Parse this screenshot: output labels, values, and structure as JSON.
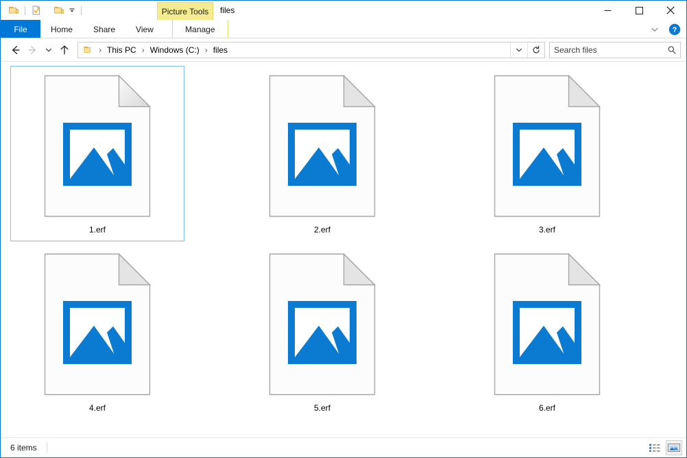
{
  "window": {
    "title": "files",
    "accent_color": "#0078d7",
    "selection_border_color": "#7fc0eb",
    "picture_glyph_color": "#0a7bd0",
    "tools_tab_color": "#f5ec91"
  },
  "quick_access": {
    "items": [
      {
        "name": "new-folder-icon",
        "label": "New folder"
      },
      {
        "name": "properties-icon",
        "label": "Properties"
      },
      {
        "name": "folder-icon",
        "label": "Folder"
      },
      {
        "name": "customize-chevron-icon",
        "label": "Customize Quick Access Toolbar"
      }
    ]
  },
  "contextual_tools": {
    "label": "Picture Tools"
  },
  "window_controls": {
    "minimize": "Minimize",
    "maximize": "Maximize",
    "close": "Close",
    "collapse_ribbon": "Minimize the Ribbon",
    "help": "Help"
  },
  "ribbon": {
    "tabs": [
      {
        "label": "File",
        "active": false,
        "type": "file"
      },
      {
        "label": "Home",
        "active": false,
        "type": "normal"
      },
      {
        "label": "Share",
        "active": false,
        "type": "normal"
      },
      {
        "label": "View",
        "active": false,
        "type": "normal"
      },
      {
        "label": "Manage",
        "active": true,
        "type": "contextual"
      }
    ]
  },
  "navigation": {
    "back": "Back",
    "forward": "Forward",
    "recent": "Recent locations",
    "up": "Up one level",
    "address": {
      "crumbs": [
        "This PC",
        "Windows (C:)",
        "files"
      ],
      "separator": "›",
      "dropdown": "Previous locations",
      "refresh": "Refresh"
    },
    "search": {
      "placeholder": "Search files",
      "value": ""
    }
  },
  "files": {
    "items": [
      {
        "name": "1.erf",
        "selected": true
      },
      {
        "name": "2.erf",
        "selected": false
      },
      {
        "name": "3.erf",
        "selected": false
      },
      {
        "name": "4.erf",
        "selected": false
      },
      {
        "name": "5.erf",
        "selected": false
      },
      {
        "name": "6.erf",
        "selected": false
      }
    ]
  },
  "status": {
    "item_count": "6 items",
    "views": [
      {
        "name": "details-view-button",
        "label": "Details view",
        "active": false
      },
      {
        "name": "large-icons-view-button",
        "label": "Large icons view",
        "active": true
      }
    ]
  }
}
